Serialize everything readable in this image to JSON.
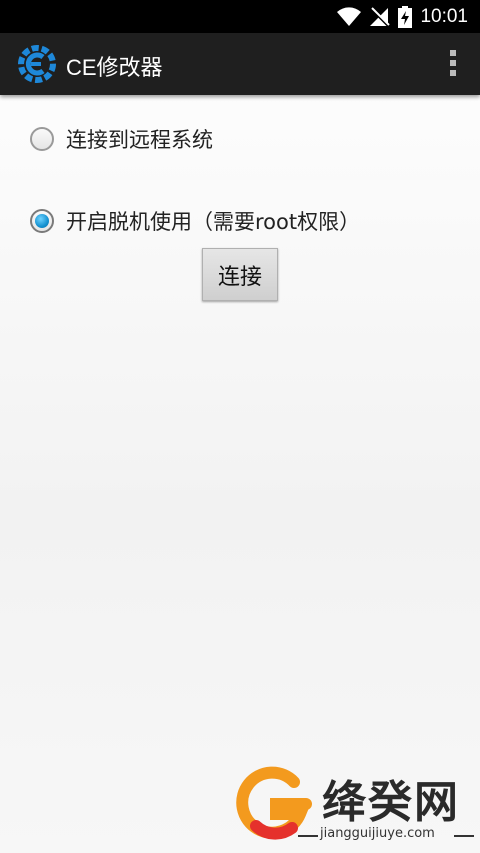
{
  "status_bar": {
    "time": "10:01",
    "icons": [
      "wifi-icon",
      "no-sim-icon",
      "battery-charging-icon"
    ]
  },
  "app_bar": {
    "title": "CE修改器",
    "logo_icon": "cheat-engine-logo-icon",
    "menu_icon": "overflow-menu-icon"
  },
  "options": [
    {
      "label": "连接到远程系统",
      "checked": false
    },
    {
      "label": "开启脱机使用（需要root权限）",
      "checked": true
    }
  ],
  "connect_button": {
    "label": "连接"
  },
  "watermark": {
    "text": "绛癸网",
    "url": "jiangguijiuye.com"
  },
  "colors": {
    "status_bar": "#000000",
    "app_bar": "#1f1f1f",
    "radio_accent": "#1592d1",
    "watermark_orange": "#f39a1e",
    "watermark_red": "#e5312c"
  }
}
